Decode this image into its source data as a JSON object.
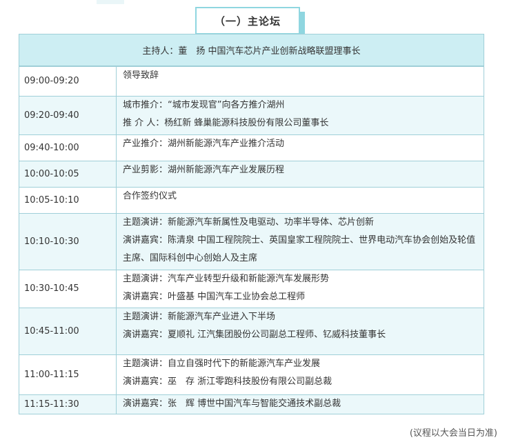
{
  "section_title": "（一）主论坛",
  "host": "主持人：董　扬 中国汽车芯片产业创新战略联盟理事长",
  "rows": [
    {
      "time": "09:00-09:20",
      "lines": [
        "领导致辞"
      ]
    },
    {
      "time": "09:20-09:40",
      "lines": [
        "城市推介：“城市发现官”向各方推介湖州",
        "推 介 人：杨红新 蜂巢能源科技股份有限公司董事长"
      ]
    },
    {
      "time": "09:40-10:00",
      "lines": [
        "产业推介：湖州新能源汽车产业推介活动"
      ]
    },
    {
      "time": "10:00-10:05",
      "lines": [
        "产业剪影：湖州新能源汽车产业发展历程"
      ]
    },
    {
      "time": "10:05-10:10",
      "lines": [
        "合作签约仪式"
      ]
    },
    {
      "time": "10:10-10:30",
      "lines": [
        "主题演讲：新能源汽车新属性及电驱动、功率半导体、芯片创新",
        "演讲嘉宾：陈清泉 中国工程院院士、英国皇家工程院院士、世界电动汽车协会创始及轮值主席、国际科创中心创始人及主席"
      ]
    },
    {
      "time": "10:30-10:45",
      "lines": [
        "主题演讲：汽车产业转型升级和新能源汽车发展形势",
        "演讲嘉宾：叶盛基 中国汽车工业协会总工程师"
      ]
    },
    {
      "time": "10:45-11:00",
      "lines": [
        "主题演讲：新能源汽车产业进入下半场",
        "演讲嘉宾：夏顺礼 江汽集团股份公司副总工程师、钇威科技董事长"
      ]
    },
    {
      "time": "11:00-11:15",
      "lines": [
        "主题演讲：自立自强时代下的新能源汽车产业发展",
        "演讲嘉宾：巫　存 浙江零跑科技股份有限公司副总裁"
      ]
    },
    {
      "time": "11:15-11:30",
      "lines": [
        "演讲嘉宾：张　辉 博世中国汽车与智能交通技术副总裁"
      ]
    }
  ],
  "note": "(议程以大会当日为准)"
}
